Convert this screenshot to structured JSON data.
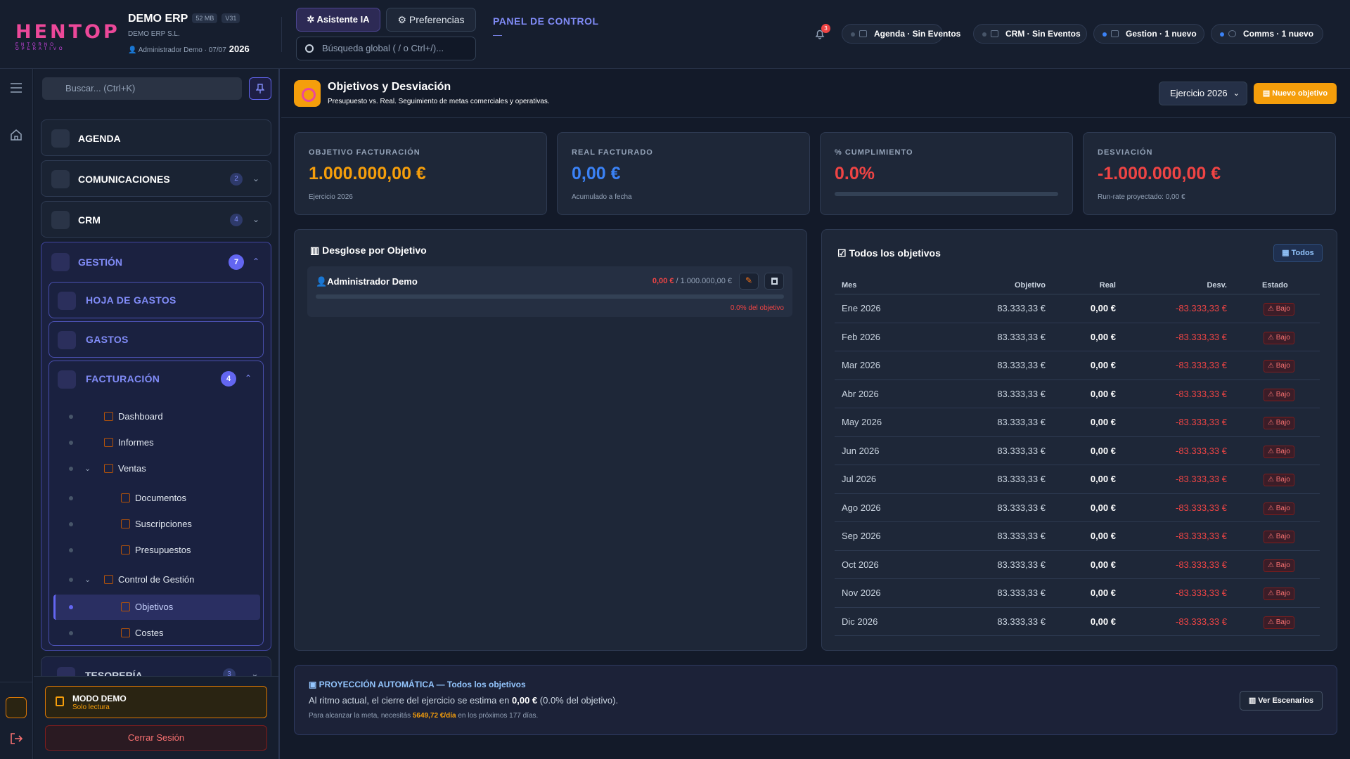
{
  "brand": {
    "logo": "HENTOP",
    "logo_sub": "ENTORNO OPERATIVO"
  },
  "company": {
    "name": "DEMO ERP",
    "size": "52 MB",
    "version": "V31",
    "legal": "DEMO ERP S.L.",
    "user": "Administrador Demo",
    "date": "07/07",
    "year": "2026"
  },
  "toolbar": {
    "ai_label": "Asistente IA",
    "prefs_label": "Preferencias",
    "search_placeholder": "Búsqueda global ( / o Ctrl+/)...",
    "panel_title": "PANEL DE CONTROL",
    "panel_dash": "—"
  },
  "notifications": {
    "count": "3"
  },
  "chips": [
    {
      "label": "Agenda · Sin Eventos",
      "status": "idle"
    },
    {
      "label": "CRM · Sin Eventos",
      "status": "idle"
    },
    {
      "label": "Gestion · 1 nuevo",
      "status": "new"
    },
    {
      "label": "Comms · 1 nuevo",
      "status": "new"
    }
  ],
  "sidebar": {
    "search_placeholder": "Buscar... (Ctrl+K)",
    "agenda": "AGENDA",
    "comunicaciones": {
      "label": "COMUNICACIONES",
      "count": "2"
    },
    "crm": {
      "label": "CRM",
      "count": "4"
    },
    "gestion": {
      "label": "GESTIÓN",
      "count": "7"
    },
    "hoja": "HOJA DE GASTOS",
    "gastos": "GASTOS",
    "facturacion": {
      "label": "FACTURACIÓN",
      "count": "4"
    },
    "tree": [
      "Dashboard",
      "Informes",
      "Ventas",
      "Documentos",
      "Suscripciones",
      "Presupuestos",
      "Control de Gestión",
      "Objetivos",
      "Costes"
    ],
    "tesoreria": {
      "label": "TESORERÍA",
      "count": "3"
    },
    "demo_title": "MODO DEMO",
    "demo_sub": "Solo lectura",
    "logout": "Cerrar Sesión"
  },
  "page": {
    "title": "Objetivos y Desviación",
    "subtitle": "Presupuesto vs. Real. Seguimiento de metas comerciales y operativas.",
    "year_select": "Ejercicio 2026",
    "new_button": "Nuevo objetivo"
  },
  "kpis": [
    {
      "label": "OBJETIVO FACTURACIÓN",
      "value": "1.000.000,00 €",
      "sub": "Ejercicio 2026",
      "color": "#f59e0b"
    },
    {
      "label": "REAL FACTURADO",
      "value": "0,00 €",
      "sub": "Acumulado a fecha",
      "color": "#3b82f6"
    },
    {
      "label": "% CUMPLIMIENTO",
      "value": "0.0%",
      "progress": 0,
      "color": "#ef4444"
    },
    {
      "label": "DESVIACIÓN",
      "value": "-1.000.000,00 €",
      "sub": "Run-rate proyectado: 0,00 €",
      "color": "#ef4444"
    }
  ],
  "breakdown": {
    "title": "Desglose por Objetivo",
    "owner": "Administrador Demo",
    "real": "0,00 €",
    "target": "/ 1.000.000,00 €",
    "pct": "0.0% del objetivo",
    "progress": 0
  },
  "table": {
    "title": "Todos los objetivos",
    "filter": "Todos",
    "headers": [
      "Mes",
      "Objetivo",
      "Real",
      "Desv.",
      "Estado"
    ],
    "rows": [
      [
        "Ene 2026",
        "83.333,33 €",
        "0,00 €",
        "-83.333,33 €",
        "⚠ Bajo"
      ],
      [
        "Feb 2026",
        "83.333,33 €",
        "0,00 €",
        "-83.333,33 €",
        "⚠ Bajo"
      ],
      [
        "Mar 2026",
        "83.333,33 €",
        "0,00 €",
        "-83.333,33 €",
        "⚠ Bajo"
      ],
      [
        "Abr 2026",
        "83.333,33 €",
        "0,00 €",
        "-83.333,33 €",
        "⚠ Bajo"
      ],
      [
        "May 2026",
        "83.333,33 €",
        "0,00 €",
        "-83.333,33 €",
        "⚠ Bajo"
      ],
      [
        "Jun 2026",
        "83.333,33 €",
        "0,00 €",
        "-83.333,33 €",
        "⚠ Bajo"
      ],
      [
        "Jul 2026",
        "83.333,33 €",
        "0,00 €",
        "-83.333,33 €",
        "⚠ Bajo"
      ],
      [
        "Ago 2026",
        "83.333,33 €",
        "0,00 €",
        "-83.333,33 €",
        "⚠ Bajo"
      ],
      [
        "Sep 2026",
        "83.333,33 €",
        "0,00 €",
        "-83.333,33 €",
        "⚠ Bajo"
      ],
      [
        "Oct 2026",
        "83.333,33 €",
        "0,00 €",
        "-83.333,33 €",
        "⚠ Bajo"
      ],
      [
        "Nov 2026",
        "83.333,33 €",
        "0,00 €",
        "-83.333,33 €",
        "⚠ Bajo"
      ],
      [
        "Dic 2026",
        "83.333,33 €",
        "0,00 €",
        "-83.333,33 €",
        "⚠ Bajo"
      ]
    ]
  },
  "projection": {
    "title": "PROYECCIÓN AUTOMÁTICA — Todos los objetivos",
    "line1_a": "Al ritmo actual, el cierre del ejercicio se estima en ",
    "line1_b": "0,00 €",
    "line1_c": " (0.0% del objetivo).",
    "line2_a": "Para alcanzar la meta, necesitás ",
    "line2_b": "5649,72 €/día",
    "line2_c": " en los próximos 177 días.",
    "button": "Ver Escenarios"
  }
}
